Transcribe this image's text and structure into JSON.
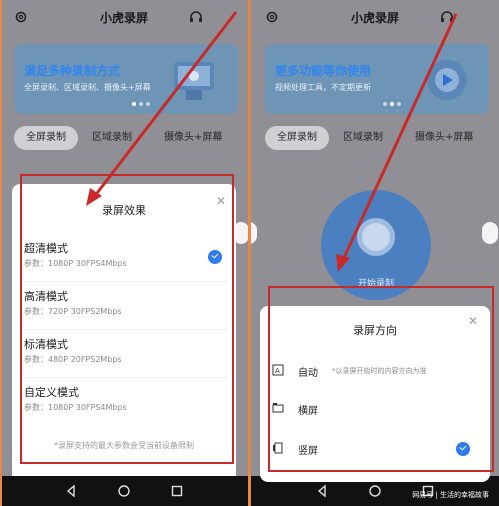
{
  "app": {
    "title": "小虎录屏"
  },
  "left": {
    "banner": {
      "title": "满足多种录制方式",
      "subtitle": "全屏录制、区域录制、摄像头+屏幕"
    },
    "tabs": [
      "全屏录制",
      "区域录制",
      "摄像头+屏幕"
    ],
    "sheet": {
      "title": "录屏效果",
      "options": [
        {
          "name": "超清模式",
          "params": "参数：1080P 30FPS4Mbps",
          "selected": true
        },
        {
          "name": "高清模式",
          "params": "参数：720P 30FPS2Mbps",
          "selected": false
        },
        {
          "name": "标清模式",
          "params": "参数：480P 20FPS2Mbps",
          "selected": false
        },
        {
          "name": "自定义模式",
          "params": "参数：1080P 30FPS4Mbps",
          "selected": false
        }
      ],
      "note": "*录屏支持的最大参数会受当前设备限制"
    }
  },
  "right": {
    "banner": {
      "title": "更多功能等你使用",
      "subtitle": "视频处理工具，不定期更新"
    },
    "tabs": [
      "全屏录制",
      "区域录制",
      "摄像头+屏幕"
    ],
    "record_label": "开始录制",
    "sheet": {
      "title": "录屏方向",
      "options": [
        {
          "name": "自动",
          "hint": "*以录屏开始时的内容方向为准",
          "selected": false,
          "icon": "auto-orientation-icon"
        },
        {
          "name": "横屏",
          "hint": "",
          "selected": false,
          "icon": "landscape-icon"
        },
        {
          "name": "竖屏",
          "hint": "",
          "selected": true,
          "icon": "portrait-icon"
        }
      ]
    }
  },
  "watermark": "网易号 | 生活的幸福故事",
  "colors": {
    "accent": "#2e7bea",
    "annotation": "#c82a2a",
    "frame": "#e7874a"
  },
  "icons": {
    "settings": "gear-icon",
    "support": "headset-icon",
    "close": "close-icon",
    "check": "check-icon"
  }
}
